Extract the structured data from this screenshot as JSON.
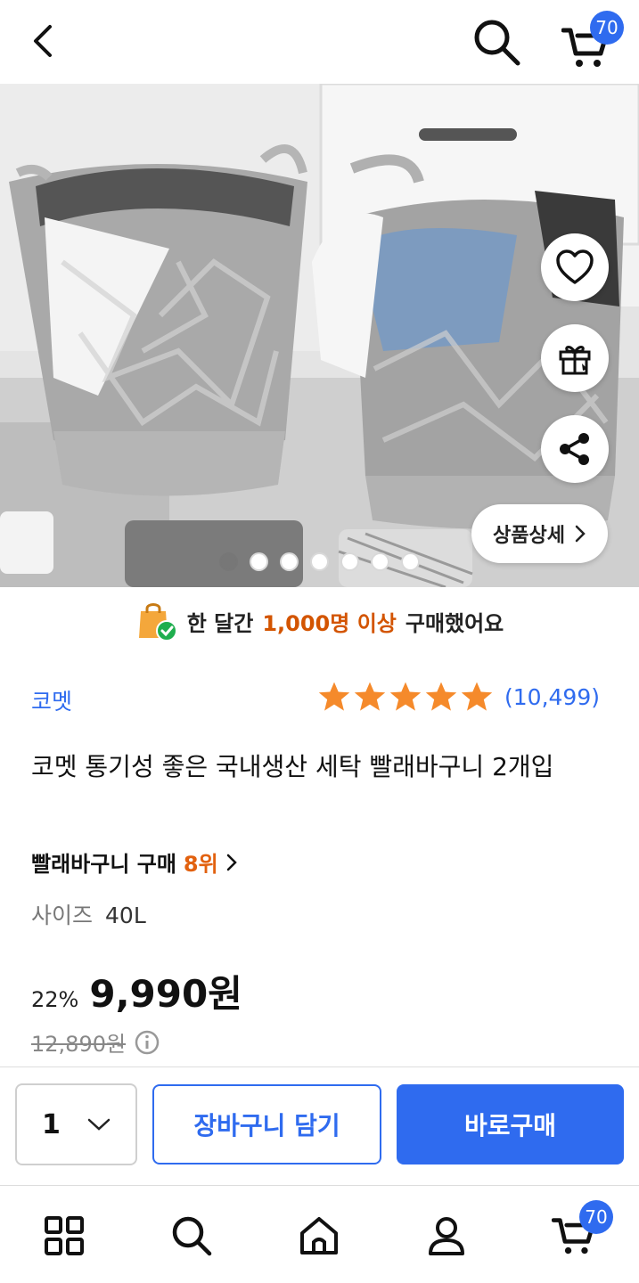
{
  "header": {
    "back_icon": "chevron-left-icon",
    "search_icon": "search-icon",
    "cart_icon": "cart-icon",
    "cart_count": "70"
  },
  "hero": {
    "detail_label": "상품상세",
    "side_buttons": [
      "heart-icon",
      "gift-icon",
      "share-icon"
    ],
    "slide_total": 7,
    "slide_active": 1
  },
  "banner": {
    "pre": "한 달간",
    "highlight": "1,000명 이상",
    "post": "구매했어요",
    "highlight_color": "#d35400"
  },
  "product": {
    "brand": "코멧",
    "rating_stars": 5,
    "review_count": "(10,499)",
    "title": "코멧 통기성 좋은 국내생산 세탁 빨래바구니 2개입",
    "rank_label": "빨래바구니 구매",
    "rank_value": "8위",
    "option_label": "사이즈",
    "option_value": "40L",
    "discount": "22%",
    "price": "9,990원",
    "original_price": "12,890원"
  },
  "buybar": {
    "quantity": "1",
    "add_to_cart": "장바구니 담기",
    "buy_now": "바로구매",
    "accent": "#2f6bef"
  },
  "nav": {
    "items": [
      "category-icon",
      "search-icon",
      "home-icon",
      "user-icon",
      "cart-icon"
    ],
    "cart_count": "70"
  }
}
